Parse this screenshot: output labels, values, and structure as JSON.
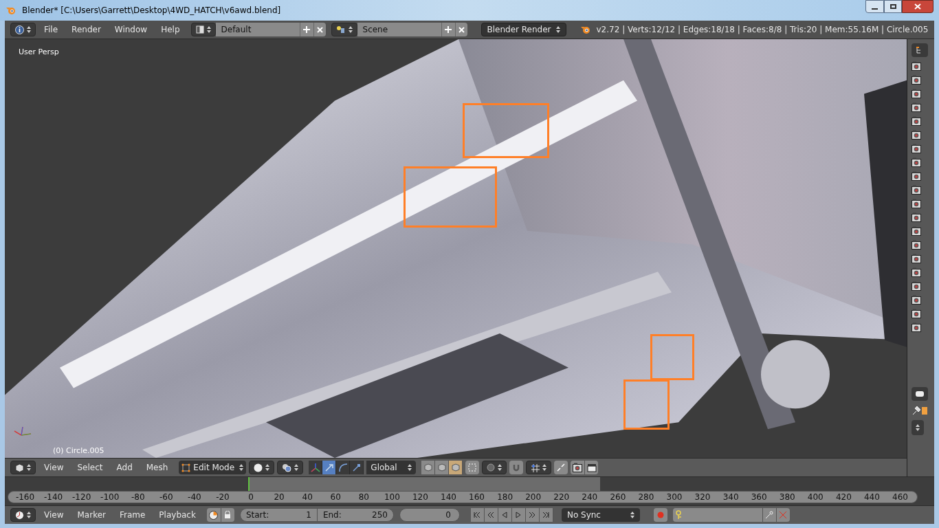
{
  "window": {
    "title": "Blender* [C:\\Users\\Garrett\\Desktop\\4WD_HATCH\\v6awd.blend]"
  },
  "info_header": {
    "menus": [
      "File",
      "Render",
      "Window",
      "Help"
    ],
    "layout": "Default",
    "scene": "Scene",
    "engine": "Blender Render",
    "stats": "v2.72 | Verts:12/12 | Edges:18/18 | Faces:8/8 | Tris:20 | Mem:55.16M | Circle.005"
  },
  "viewport": {
    "view_label": "User Persp",
    "object_label": "(0) Circle.005"
  },
  "viewport_header": {
    "menus": [
      "View",
      "Select",
      "Add",
      "Mesh"
    ],
    "mode": "Edit Mode",
    "orientation": "Global",
    "manipulators": [
      {
        "kind": "axes",
        "selected": false
      },
      {
        "kind": "translate",
        "selected": true
      },
      {
        "kind": "rotate",
        "selected": false
      },
      {
        "kind": "scale",
        "selected": false
      }
    ],
    "select_modes": [
      {
        "selected": false
      },
      {
        "selected": false
      },
      {
        "selected": true
      }
    ]
  },
  "timeline": {
    "ticks": [
      "-160",
      "-140",
      "-120",
      "-100",
      "-80",
      "-60",
      "-40",
      "-20",
      "0",
      "20",
      "40",
      "60",
      "80",
      "100",
      "120",
      "140",
      "160",
      "180",
      "200",
      "220",
      "240",
      "260",
      "280",
      "300",
      "320",
      "340",
      "360",
      "380",
      "400",
      "420",
      "440",
      "460"
    ]
  },
  "timeline_header": {
    "menus": [
      "View",
      "Marker",
      "Frame",
      "Playback"
    ],
    "start_label": "Start:",
    "start": "1",
    "end_label": "End:",
    "end": "250",
    "current": "0",
    "sync": "No Sync"
  }
}
